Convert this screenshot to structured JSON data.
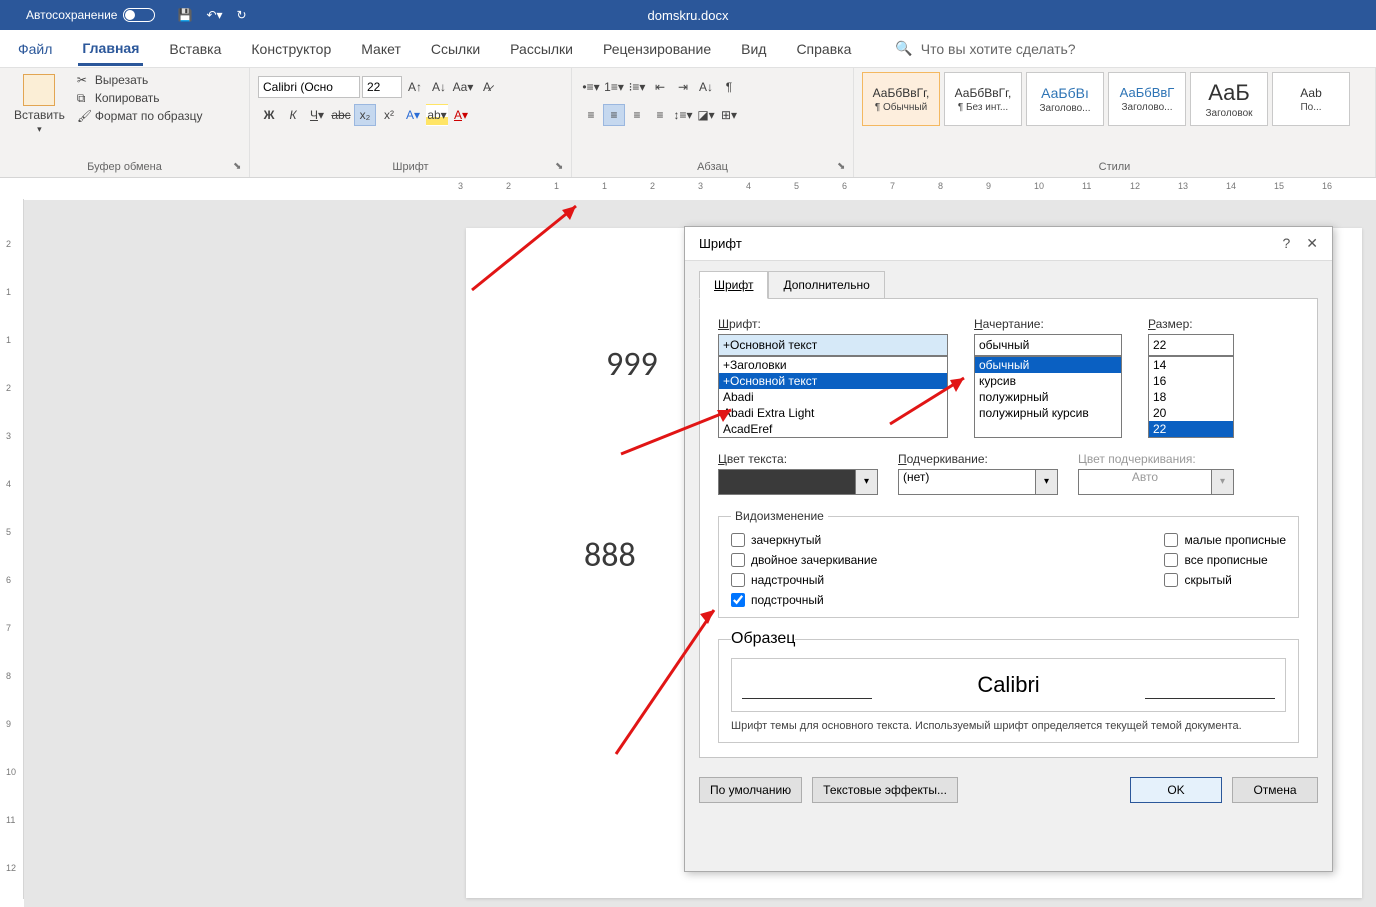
{
  "titlebar": {
    "autosave": "Автосохранение",
    "filename": "domskru.docx"
  },
  "tabs": {
    "file": "Файл",
    "home": "Главная",
    "insert": "Вставка",
    "design": "Конструктор",
    "layout": "Макет",
    "references": "Ссылки",
    "mailings": "Рассылки",
    "review": "Рецензирование",
    "view": "Вид",
    "help": "Справка",
    "search_placeholder": "Что вы хотите сделать?"
  },
  "ribbon": {
    "clipboard": {
      "label": "Буфер обмена",
      "paste": "Вставить",
      "cut": "Вырезать",
      "copy": "Копировать",
      "format_painter": "Формат по образцу"
    },
    "font": {
      "label": "Шрифт",
      "name": "Calibri (Осно",
      "size": "22"
    },
    "paragraph": {
      "label": "Абзац"
    },
    "styles": {
      "label": "Стили",
      "items": [
        {
          "preview": "АаБбВвГг,",
          "name": "¶ Обычный"
        },
        {
          "preview": "АаБбВвГг,",
          "name": "¶ Без инт..."
        },
        {
          "preview": "АаБбВı",
          "name": "Заголово..."
        },
        {
          "preview": "АаБбВвГ",
          "name": "Заголово..."
        },
        {
          "preview": "АаБ",
          "name": "Заголовок"
        },
        {
          "preview": "Ааb",
          "name": "По..."
        }
      ]
    }
  },
  "document": {
    "line1": "999",
    "line2": "888"
  },
  "ruler_h": [
    "3",
    "2",
    "1",
    "1",
    "2",
    "3",
    "4",
    "5",
    "6",
    "7",
    "8",
    "9",
    "10",
    "11",
    "12",
    "13",
    "14",
    "15",
    "16"
  ],
  "ruler_v": [
    "2",
    "1",
    "1",
    "2",
    "3",
    "4",
    "5",
    "6",
    "7",
    "8",
    "9",
    "10",
    "11",
    "12"
  ],
  "dialog": {
    "title": "Шрифт",
    "help": "?",
    "tab_font": "Шрифт",
    "tab_advanced": "Дополнительно",
    "font_label": "Шрифт:",
    "font_value": "+Основной текст",
    "font_options": [
      "+Заголовки",
      "+Основной текст",
      "Abadi",
      "Abadi Extra Light",
      "AcadEref"
    ],
    "style_label": "Начертание:",
    "style_value": "обычный",
    "style_options": [
      "обычный",
      "курсив",
      "полужирный",
      "полужирный курсив"
    ],
    "size_label": "Размер:",
    "size_value": "22",
    "size_options": [
      "14",
      "16",
      "18",
      "20",
      "22"
    ],
    "color_label": "Цвет текста:",
    "underline_label": "Подчеркивание:",
    "underline_value": "(нет)",
    "underline_color_label": "Цвет подчеркивания:",
    "underline_color_value": "Авто",
    "effects_label": "Видоизменение",
    "chk_strike": "зачеркнутый",
    "chk_dblstrike": "двойное зачеркивание",
    "chk_super": "надстрочный",
    "chk_sub": "подстрочный",
    "chk_smallcaps": "малые прописные",
    "chk_allcaps": "все прописные",
    "chk_hidden": "скрытый",
    "sample_label": "Образец",
    "sample_text": "Calibri",
    "note": "Шрифт темы для основного текста. Используемый шрифт определяется текущей темой документа.",
    "btn_default": "По умолчанию",
    "btn_texteffects": "Текстовые эффекты...",
    "btn_ok": "OK",
    "btn_cancel": "Отмена"
  }
}
